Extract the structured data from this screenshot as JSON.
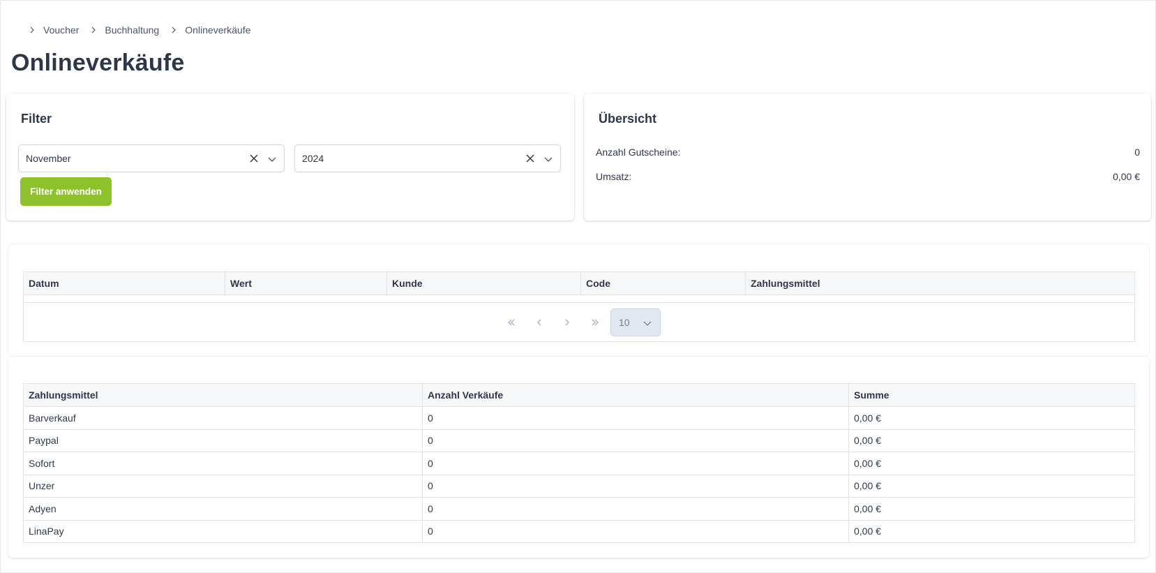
{
  "breadcrumb": [
    "Voucher",
    "Buchhaltung",
    "Onlineverkäufe"
  ],
  "page_title": "Onlineverkäufe",
  "filter": {
    "title": "Filter",
    "month_value": "November",
    "year_value": "2024",
    "apply_label": "Filter anwenden",
    "accent_color": "#8ec22a"
  },
  "overview": {
    "title": "Übersicht",
    "rows": [
      {
        "label": "Anzahl Gutscheine:",
        "value": "0"
      },
      {
        "label": "Umsatz:",
        "value": "0,00 €"
      }
    ]
  },
  "sales_table": {
    "columns": [
      "Datum",
      "Wert",
      "Kunde",
      "Code",
      "Zahlungsmittel"
    ],
    "rows": [],
    "per_page": "10"
  },
  "summary_table": {
    "columns": [
      "Zahlungsmittel",
      "Anzahl Verkäufe",
      "Summe"
    ],
    "rows": [
      [
        "Barverkauf",
        "0",
        "0,00 €"
      ],
      [
        "Paypal",
        "0",
        "0,00 €"
      ],
      [
        "Sofort",
        "0",
        "0,00 €"
      ],
      [
        "Unzer",
        "0",
        "0,00 €"
      ],
      [
        "Adyen",
        "0",
        "0,00 €"
      ],
      [
        "LinaPay",
        "0",
        "0,00 €"
      ]
    ]
  }
}
